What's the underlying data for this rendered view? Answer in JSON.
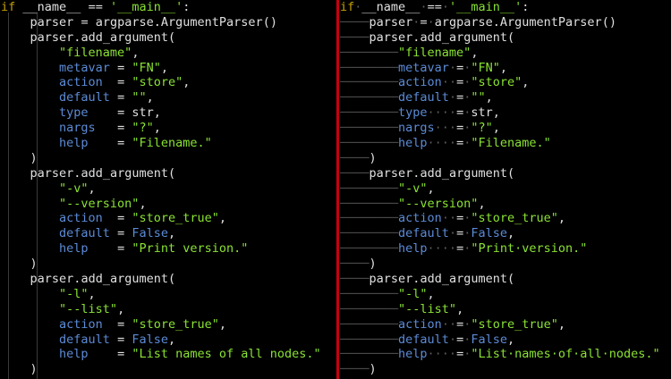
{
  "editor": {
    "colors": {
      "keyword": "#c4a000",
      "string": "#8ae234",
      "kwarg": "#5c8bd6",
      "text": "#e8e8e8",
      "divider": "#c8000f",
      "background": "#000000",
      "whitespace_marker": "#5e5e5e"
    },
    "left_lines": [
      "if __name__ == '__main__':",
      "    parser = argparse.ArgumentParser()",
      "    parser.add_argument(",
      "        \"filename\",",
      "        metavar = \"FN\",",
      "        action  = \"store\",",
      "        default = \"\",",
      "        type    = str,",
      "        nargs   = \"?\",",
      "        help    = \"Filename.\"",
      "    )",
      "    parser.add_argument(",
      "        \"-v\",",
      "        \"--version\",",
      "        action  = \"store_true\",",
      "        default = False,",
      "        help    = \"Print version.\"",
      "    )",
      "    parser.add_argument(",
      "        \"-l\",",
      "        \"--list\",",
      "        action  = \"store_true\",",
      "        default = False,",
      "        help    = \"List names of all nodes.\"",
      "    )"
    ],
    "right_lines": [
      "if·__name__·==·'__main__':",
      "────parser·=·argparse.ArgumentParser()",
      "────parser.add_argument(",
      "────────\"filename\",",
      "────────metavar·=·\"FN\",",
      "────────action··=·\"store\",",
      "────────default·=·\"\",",
      "────────type····=·str,",
      "────────nargs···=·\"?\",",
      "────────help····=·\"Filename.\"",
      "────)",
      "────parser.add_argument(",
      "────────\"-v\",",
      "────────\"--version\",",
      "────────action··=·\"store_true\",",
      "────────default·=·False,",
      "────────help····=·\"Print·version.\"",
      "────)",
      "────parser.add_argument(",
      "────────\"-l\",",
      "────────\"--list\",",
      "────────action··=·\"store_true\",",
      "────────default·=·False,",
      "────────help····=·\"List·names·of·all·nodes.\"",
      "────)"
    ]
  }
}
